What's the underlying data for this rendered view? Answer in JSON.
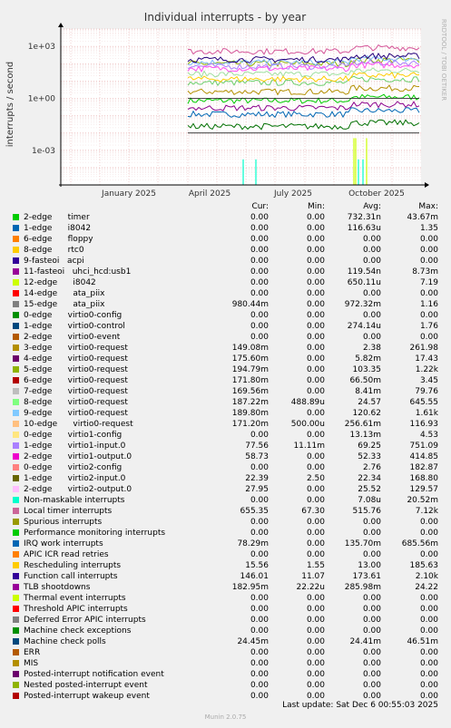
{
  "chart_data": {
    "type": "line",
    "title": "Individual interrupts - by year",
    "ylabel": "interrupts / second",
    "yscale": "log",
    "ylim": [
      1e-05,
      10000
    ],
    "yticks": [
      "1e+03",
      "1e+00",
      "1e-03"
    ],
    "yticks_values": [
      1000,
      1,
      0.001
    ],
    "xticks": [
      "January 2025",
      "April 2025",
      "July 2025",
      "October 2025"
    ],
    "grid": true,
    "watermark": "RRDTOOL / TOBI OETIKER",
    "series": [
      {
        "name": "timer",
        "color": "#00cc00",
        "approx_level": 0.73
      },
      {
        "name": "i8042",
        "color": "#0066b3",
        "approx_level": 0.12
      },
      {
        "name": "virtio0-request (3)",
        "color": "#b38f00",
        "approx_level": 2.4
      },
      {
        "name": "virtio0-request (5)",
        "color": "#8fb300",
        "approx_level": 100
      },
      {
        "name": "virtio0-request (7)",
        "color": "#6ccf6c",
        "approx_level": 8
      },
      {
        "name": "virtio0-request (8)",
        "color": "#a0e0a0",
        "approx_level": 25
      },
      {
        "name": "virtio0-request (9)",
        "color": "#7ab9ff",
        "approx_level": 120
      },
      {
        "name": "virtio1-input.0",
        "color": "#aa80ff",
        "approx_level": 70
      },
      {
        "name": "virtio1-output.0",
        "color": "#ff4df0",
        "approx_level": 52
      },
      {
        "name": "Local timer interrupts",
        "color": "#d5569a",
        "approx_level": 515
      },
      {
        "name": "Function call interrupts",
        "color": "#24007a",
        "approx_level": 173
      },
      {
        "name": "TLB shootdowns",
        "color": "#8c008c",
        "approx_level": 0.28
      },
      {
        "name": "Machine check polls",
        "color": "#006f00",
        "approx_level": 0.024
      },
      {
        "name": "Rescheduling interrupts",
        "color": "#ffcc00",
        "approx_level": 13
      }
    ]
  },
  "legend": {
    "headers": {
      "cur": "Cur:",
      "min": "Min:",
      "avg": "Avg:",
      "max": "Max:"
    },
    "rows": [
      {
        "color": "#00cc00",
        "name": "2-edge      timer",
        "cur": "0.00",
        "min": "0.00",
        "avg": "732.31n",
        "max": "43.67m"
      },
      {
        "color": "#0066b3",
        "name": "1-edge      i8042",
        "cur": "0.00",
        "min": "0.00",
        "avg": "116.63u",
        "max": "1.35"
      },
      {
        "color": "#ff8000",
        "name": "6-edge      floppy",
        "cur": "0.00",
        "min": "0.00",
        "avg": "0.00",
        "max": "0.00"
      },
      {
        "color": "#ffcc00",
        "name": "8-edge      rtc0",
        "cur": "0.00",
        "min": "0.00",
        "avg": "0.00",
        "max": "0.00"
      },
      {
        "color": "#330099",
        "name": "9-fasteoi   acpi",
        "cur": "0.00",
        "min": "0.00",
        "avg": "0.00",
        "max": "0.00"
      },
      {
        "color": "#990099",
        "name": "11-fasteoi   uhci_hcd:usb1",
        "cur": "0.00",
        "min": "0.00",
        "avg": "119.54n",
        "max": "8.73m"
      },
      {
        "color": "#ccff00",
        "name": "12-edge      i8042",
        "cur": "0.00",
        "min": "0.00",
        "avg": "650.11u",
        "max": "7.19"
      },
      {
        "color": "#ff0000",
        "name": "14-edge      ata_piix",
        "cur": "0.00",
        "min": "0.00",
        "avg": "0.00",
        "max": "0.00"
      },
      {
        "color": "#808080",
        "name": "15-edge      ata_piix",
        "cur": "980.44m",
        "min": "0.00",
        "avg": "972.32m",
        "max": "1.16"
      },
      {
        "color": "#008f00",
        "name": "0-edge      virtio0-config",
        "cur": "0.00",
        "min": "0.00",
        "avg": "0.00",
        "max": "0.00"
      },
      {
        "color": "#00487d",
        "name": "1-edge      virtio0-control",
        "cur": "0.00",
        "min": "0.00",
        "avg": "274.14u",
        "max": "1.76"
      },
      {
        "color": "#b35a00",
        "name": "2-edge      virtio0-event",
        "cur": "0.00",
        "min": "0.00",
        "avg": "0.00",
        "max": "0.00"
      },
      {
        "color": "#b38f00",
        "name": "3-edge      virtio0-request",
        "cur": "149.08m",
        "min": "0.00",
        "avg": "2.38",
        "max": "261.98"
      },
      {
        "color": "#6b006b",
        "name": "4-edge      virtio0-request",
        "cur": "175.60m",
        "min": "0.00",
        "avg": "5.82m",
        "max": "17.43"
      },
      {
        "color": "#8fb300",
        "name": "5-edge      virtio0-request",
        "cur": "194.79m",
        "min": "0.00",
        "avg": "103.35",
        "max": "1.22k"
      },
      {
        "color": "#b30000",
        "name": "6-edge      virtio0-request",
        "cur": "171.80m",
        "min": "0.00",
        "avg": "66.50m",
        "max": "3.45"
      },
      {
        "color": "#bebebe",
        "name": "7-edge      virtio0-request",
        "cur": "169.56m",
        "min": "0.00",
        "avg": "8.41m",
        "max": "79.76"
      },
      {
        "color": "#80ff80",
        "name": "8-edge      virtio0-request",
        "cur": "187.22m",
        "min": "488.89u",
        "avg": "24.57",
        "max": "645.55"
      },
      {
        "color": "#80c9ff",
        "name": "9-edge      virtio0-request",
        "cur": "189.80m",
        "min": "0.00",
        "avg": "120.62",
        "max": "1.61k"
      },
      {
        "color": "#ffc080",
        "name": "10-edge      virtio0-request",
        "cur": "171.20m",
        "min": "500.00u",
        "avg": "256.61m",
        "max": "116.93"
      },
      {
        "color": "#ffe680",
        "name": "0-edge      virtio1-config",
        "cur": "0.00",
        "min": "0.00",
        "avg": "13.13m",
        "max": "4.53"
      },
      {
        "color": "#aa80ff",
        "name": "1-edge      virtio1-input.0",
        "cur": "77.56",
        "min": "11.11m",
        "avg": "69.25",
        "max": "751.09"
      },
      {
        "color": "#ee00cc",
        "name": "2-edge      virtio1-output.0",
        "cur": "58.73",
        "min": "0.00",
        "avg": "52.33",
        "max": "414.85"
      },
      {
        "color": "#ff8080",
        "name": "0-edge      virtio2-config",
        "cur": "0.00",
        "min": "0.00",
        "avg": "2.76",
        "max": "182.87"
      },
      {
        "color": "#666600",
        "name": "1-edge      virtio2-input.0",
        "cur": "22.39",
        "min": "2.50",
        "avg": "22.34",
        "max": "168.80"
      },
      {
        "color": "#ffbfff",
        "name": "2-edge      virtio2-output.0",
        "cur": "27.95",
        "min": "0.00",
        "avg": "25.52",
        "max": "129.57"
      },
      {
        "color": "#00ffcc",
        "name": "Non-maskable interrupts",
        "cur": "0.00",
        "min": "0.00",
        "avg": "7.08u",
        "max": "20.52m"
      },
      {
        "color": "#cc6699",
        "name": "Local timer interrupts",
        "cur": "655.35",
        "min": "67.30",
        "avg": "515.76",
        "max": "7.12k"
      },
      {
        "color": "#999900",
        "name": "Spurious interrupts",
        "cur": "0.00",
        "min": "0.00",
        "avg": "0.00",
        "max": "0.00"
      },
      {
        "color": "#00cc00",
        "name": "Performance monitoring interrupts",
        "cur": "0.00",
        "min": "0.00",
        "avg": "0.00",
        "max": "0.00"
      },
      {
        "color": "#0066b3",
        "name": "IRQ work interrupts",
        "cur": "78.29m",
        "min": "0.00",
        "avg": "135.70m",
        "max": "685.56m"
      },
      {
        "color": "#ff8000",
        "name": "APIC ICR read retries",
        "cur": "0.00",
        "min": "0.00",
        "avg": "0.00",
        "max": "0.00"
      },
      {
        "color": "#ffcc00",
        "name": "Rescheduling interrupts",
        "cur": "15.56",
        "min": "1.55",
        "avg": "13.00",
        "max": "185.63"
      },
      {
        "color": "#330099",
        "name": "Function call interrupts",
        "cur": "146.01",
        "min": "11.07",
        "avg": "173.61",
        "max": "2.10k"
      },
      {
        "color": "#990099",
        "name": "TLB shootdowns",
        "cur": "182.95m",
        "min": "22.22u",
        "avg": "285.98m",
        "max": "24.22"
      },
      {
        "color": "#ccff00",
        "name": "Thermal event interrupts",
        "cur": "0.00",
        "min": "0.00",
        "avg": "0.00",
        "max": "0.00"
      },
      {
        "color": "#ff0000",
        "name": "Threshold APIC interrupts",
        "cur": "0.00",
        "min": "0.00",
        "avg": "0.00",
        "max": "0.00"
      },
      {
        "color": "#808080",
        "name": "Deferred Error APIC interrupts",
        "cur": "0.00",
        "min": "0.00",
        "avg": "0.00",
        "max": "0.00"
      },
      {
        "color": "#008f00",
        "name": "Machine check exceptions",
        "cur": "0.00",
        "min": "0.00",
        "avg": "0.00",
        "max": "0.00"
      },
      {
        "color": "#00487d",
        "name": "Machine check polls",
        "cur": "24.45m",
        "min": "0.00",
        "avg": "24.41m",
        "max": "46.51m"
      },
      {
        "color": "#b35a00",
        "name": "ERR",
        "cur": "0.00",
        "min": "0.00",
        "avg": "0.00",
        "max": "0.00"
      },
      {
        "color": "#b38f00",
        "name": "MIS",
        "cur": "0.00",
        "min": "0.00",
        "avg": "0.00",
        "max": "0.00"
      },
      {
        "color": "#6b006b",
        "name": "Posted-interrupt notification event",
        "cur": "0.00",
        "min": "0.00",
        "avg": "0.00",
        "max": "0.00"
      },
      {
        "color": "#8fb300",
        "name": "Nested posted-interrupt event",
        "cur": "0.00",
        "min": "0.00",
        "avg": "0.00",
        "max": "0.00"
      },
      {
        "color": "#b30000",
        "name": "Posted-interrupt wakeup event",
        "cur": "0.00",
        "min": "0.00",
        "avg": "0.00",
        "max": "0.00"
      }
    ]
  },
  "footer": {
    "last_update": "Last update: Sat Dec  6 00:55:03 2025",
    "version": "Munin 2.0.75"
  }
}
